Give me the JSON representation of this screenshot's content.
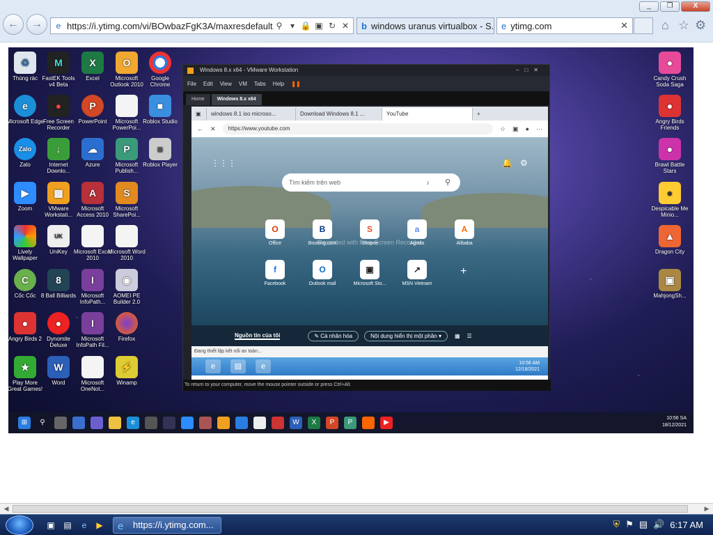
{
  "browser": {
    "address": "https://i.ytimg.com/vi/BOwbazFgK3A/maxresdefault.jpg?s",
    "tabs": [
      {
        "label": "windows uranus virtualbox - S..."
      },
      {
        "label": "ytimg.com"
      }
    ],
    "window_controls": [
      "_",
      "❐",
      "X"
    ]
  },
  "desktop_left_icons": [
    {
      "label": "Thùng rác"
    },
    {
      "label": "FastEK Tools v4 Beta"
    },
    {
      "label": "Excel"
    },
    {
      "label": "Microsoft Outlook 2010"
    },
    {
      "label": "Google Chrome"
    },
    {
      "label": "Microsoft Edge"
    },
    {
      "label": "Free Screen Recorder"
    },
    {
      "label": "PowerPoint"
    },
    {
      "label": "Microsoft PowerPoi..."
    },
    {
      "label": "Roblox Studio"
    },
    {
      "label": "Zalo"
    },
    {
      "label": "Internet Downlo..."
    },
    {
      "label": "Azure"
    },
    {
      "label": "Microsoft Publish..."
    },
    {
      "label": "Roblox Player"
    },
    {
      "label": "Zoom"
    },
    {
      "label": "VMware Workstati..."
    },
    {
      "label": "Microsoft Access 2010"
    },
    {
      "label": "Microsoft SharePoi..."
    },
    {
      "label": "Lively Wallpaper"
    },
    {
      "label": "UniKey"
    },
    {
      "label": "Microsoft Excel 2010"
    },
    {
      "label": "Microsoft Word 2010"
    },
    {
      "label": "Cốc Cốc"
    },
    {
      "label": "8 Ball Billiards"
    },
    {
      "label": "Microsoft InfoPath..."
    },
    {
      "label": "AOMEI PE Builder 2.0"
    },
    {
      "label": "Angry Birds 2"
    },
    {
      "label": "Dynomite Deluxe"
    },
    {
      "label": "Microsoft InfoPath Fil..."
    },
    {
      "label": "Firefox"
    },
    {
      "label": "Play More Great Games!"
    },
    {
      "label": "Word"
    },
    {
      "label": "Microsoft OneNot..."
    },
    {
      "label": "Winamp"
    }
  ],
  "desktop_right_icons": [
    {
      "label": "Candy Crush Soda Saga"
    },
    {
      "label": "Angry Birds Friends"
    },
    {
      "label": "Brawl Battle Stars"
    },
    {
      "label": "Despicable Me Minio..."
    },
    {
      "label": "Dragon City"
    },
    {
      "label": "MahjongSh..."
    }
  ],
  "vmware": {
    "title": "Windows 8.x x64 - VMware Workstation",
    "menu": [
      "File",
      "Edit",
      "View",
      "VM",
      "Tabs",
      "Help"
    ],
    "tabs": [
      "Home",
      "Windows 8.x x64"
    ],
    "footer": "To return to your computer, move the mouse pointer outside or press Ctrl+Alt."
  },
  "edge": {
    "tabs": [
      "windows 8.1 iso microso...",
      "Download Windows 8.1 ...",
      "YouTube"
    ],
    "url": "https://www.youtube.com",
    "search_placeholder": "Tìm kiếm trên web",
    "quick_links": [
      "Office",
      "Booking.com",
      "Shopee",
      "Agoda",
      "Alibaba",
      "Facebook",
      "Outlook mail",
      "Microsoft Sto...",
      "MSN Vietnam"
    ],
    "watermark": "Recorded with Free Screen Recorder",
    "feed_label": "Nguồn tin của tôi",
    "personalize_label": "Cá nhân hóa",
    "content_label": "Nội dung hiển thị một phần",
    "status": "Đang thiết lập kết nối an toàn...",
    "guest_time": "10:56 AM",
    "guest_date": "12/18/2021"
  },
  "inner_tray": {
    "time": "10:56 SA",
    "date": "18/12/2021"
  },
  "taskbar": {
    "task_label": "https://i.ytimg.com...",
    "time": "6:17 AM"
  }
}
